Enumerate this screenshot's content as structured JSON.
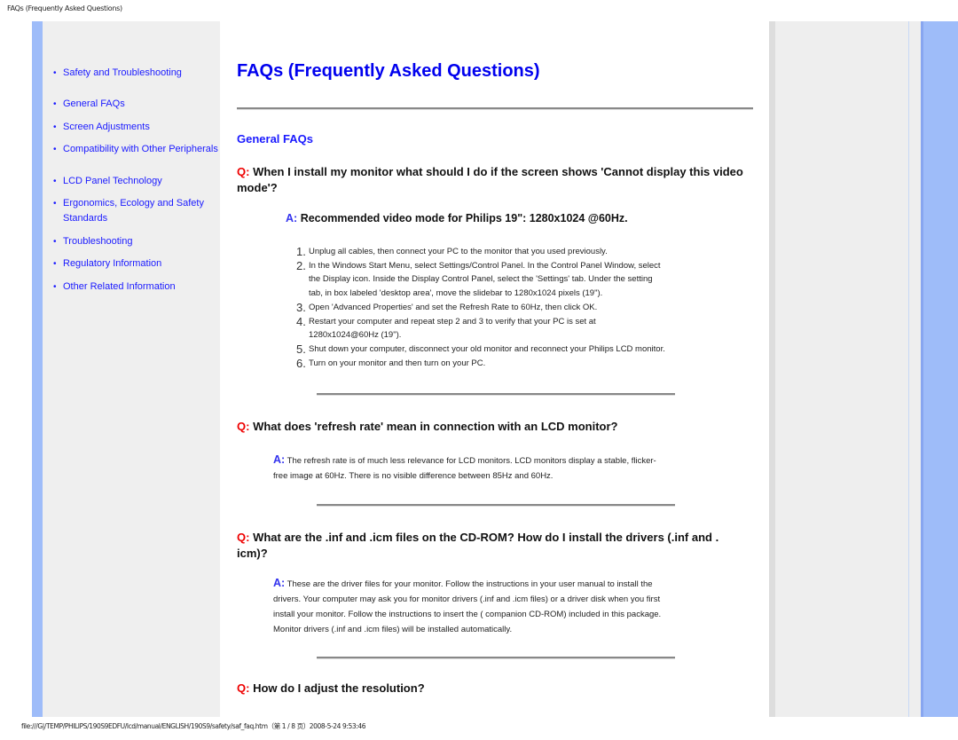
{
  "print_header": "FAQs (Frequently Asked Questions)",
  "print_footer": "file:///G|/TEMP/PHILIPS/190S9EDFU/lcd/manual/ENGLISH/190S9/safety/saf_faq.htm（第 1 / 8 页）2008-5-24 9:53:46",
  "colors": {
    "accent_blue": "#9ebcf9",
    "link": "#1a1aff",
    "title": "#0000ee",
    "q_marker": "#ee0000",
    "a_marker": "#3333ee",
    "sidebar_bg": "#efefef"
  },
  "sidebar": {
    "items": [
      {
        "label": "Safety and Troubleshooting"
      },
      {
        "label": "General FAQs"
      },
      {
        "label": "Screen Adjustments"
      },
      {
        "label": "Compatibility with Other Peripherals"
      },
      {
        "label": "LCD Panel Technology"
      },
      {
        "label": "Ergonomics, Ecology and Safety"
      },
      {
        "label": "Standards"
      },
      {
        "label": "Troubleshooting"
      },
      {
        "label": "Regulatory Information"
      },
      {
        "label": "Other Related Information"
      }
    ],
    "bullet": "•"
  },
  "main": {
    "title": "FAQs (Frequently Asked Questions)",
    "section": "General FAQs",
    "q_marker": "Q:",
    "a_marker": "A:",
    "faqs": [
      {
        "question_line1": "When I install my monitor what should I do if the screen shows 'Cannot display this video",
        "question_line2": "mode'?",
        "answer_head": "Recommended video mode for Philips 19\": 1280x1024 @60Hz.",
        "steps": [
          {
            "num": "1.",
            "lines": [
              "Unplug all cables, then connect your PC to the monitor that you used previously."
            ]
          },
          {
            "num": "2.",
            "lines": [
              "In the Windows Start Menu, select Settings/Control Panel. In the Control Panel Window, select",
              "the Display icon. Inside the Display Control Panel, select the 'Settings' tab. Under the setting",
              "tab, in box labeled 'desktop area', move the slidebar to 1280x1024 pixels (19\")."
            ]
          },
          {
            "num": "3.",
            "lines": [
              "Open 'Advanced Properties' and set the Refresh Rate to 60Hz, then click OK."
            ]
          },
          {
            "num": "4.",
            "lines": [
              "Restart your computer and repeat step 2 and 3 to verify that your PC is set at",
              "1280x1024@60Hz (19\")."
            ]
          },
          {
            "num": "5.",
            "lines": [
              "Shut down your computer, disconnect your old monitor and reconnect your Philips LCD monitor."
            ]
          },
          {
            "num": "6.",
            "lines": [
              "Turn on your monitor and then turn on your PC."
            ]
          }
        ]
      },
      {
        "question_line1": "What does 'refresh rate' mean in connection with an LCD monitor?",
        "answer_lines": [
          "The refresh rate is of much less relevance for LCD monitors. LCD monitors display a stable, flicker-",
          "free image at 60Hz. There is no visible difference between 85Hz and 60Hz."
        ]
      },
      {
        "question_line1": "What are the .inf and .icm files on the CD-ROM? How do I install the drivers (.inf and .",
        "question_line2": "icm)?",
        "answer_lines": [
          "These are the driver files for your monitor. Follow the instructions in your user manual to install the",
          "drivers. Your computer may ask you for monitor drivers (.inf and .icm files) or a driver disk when you first",
          "install your monitor. Follow the instructions to insert the ( companion CD-ROM) included in this package.",
          "Monitor drivers (.inf and .icm files) will be installed automatically."
        ]
      },
      {
        "question_line1": "How do I adjust the resolution?"
      }
    ]
  }
}
